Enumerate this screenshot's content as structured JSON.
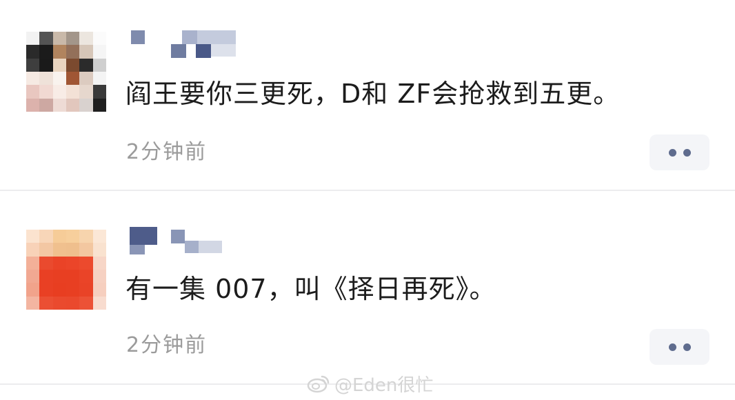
{
  "comments": [
    {
      "text": "阎王要你三更死，D和 ZF会抢救到五更。",
      "time": "2分钟前",
      "more_icon": "more-dots-icon"
    },
    {
      "text": "有一集 007，叫《择日再死》。",
      "time": "2分钟前",
      "more_icon": "more-dots-icon"
    }
  ],
  "watermark": {
    "text": "@Eden很忙",
    "icon": "weibo-logo-icon"
  },
  "colors": {
    "text": "#1c1c1c",
    "time": "#9b9b9b",
    "more_button_bg": "#f4f5f8",
    "more_dots": "#5f6c8e",
    "divider": "#ececee",
    "watermark": "#d4d4d4"
  }
}
